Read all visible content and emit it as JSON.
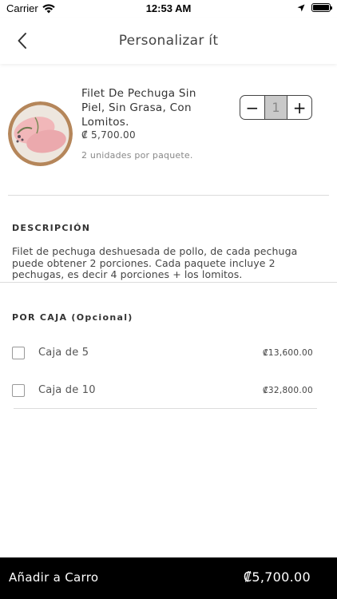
{
  "status_bar": {
    "carrier": "Carrier",
    "time": "12:53 AM"
  },
  "nav": {
    "title": "Personalizar ít",
    "back_icon": "chevron-left-icon"
  },
  "product": {
    "name": "Filet De Pechuga Sin Piel, Sin Grasa, Con Lomitos.",
    "price": "₡ 5,700.00",
    "units": "2 unidades por paquete.",
    "quantity": "1",
    "decrement_label": "−",
    "increment_label": "+"
  },
  "description": {
    "title": "DESCRIPCIÓN",
    "text": "Filet de pechuga deshuesada de pollo, de cada pechuga puede obtener 2 porciones. Cada paquete incluye 2 pechugas, es decir 4 porciones + los lomitos."
  },
  "por_caja": {
    "title": "POR CAJA (Opcional)",
    "options": [
      {
        "label": "Caja de 5",
        "price": "₡13,600.00",
        "checked": false
      },
      {
        "label": "Caja de 10",
        "price": "₡32,800.00",
        "checked": false
      }
    ]
  },
  "footer": {
    "label": "Añadir a Carro",
    "total": "₡5,700.00"
  },
  "colors": {
    "footer_bg": "#000000",
    "qty_bg": "#c9c9c9",
    "divider": "#dcdcdc"
  }
}
